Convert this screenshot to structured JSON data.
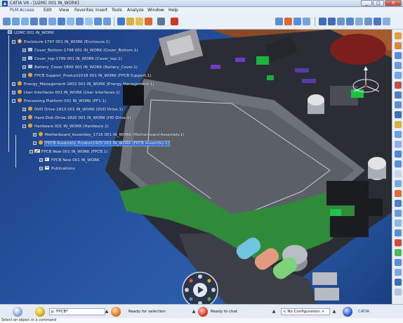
{
  "window": {
    "title": "CATIA V6 - [U2MC 001 IN_WORK]",
    "buttons": [
      "_",
      "□",
      "X"
    ]
  },
  "menu": [
    "PLM Access",
    "Edit",
    "View",
    "Favorites",
    "Insert",
    "Tools",
    "Analyze",
    "Window",
    "Help"
  ],
  "tree": {
    "root": "U2MC 001 IN_WORK",
    "nodes": [
      {
        "label": "Enclosure-1797 001 IN_WORK (Enclosure.1)"
      },
      {
        "label": "Cover_Bottom-1798 001 IN_WORK (Cover_Bottom.1)"
      },
      {
        "label": "Cover_top-1799 001 IN_WORK (Cover_top.1)"
      },
      {
        "label": "Battery_Cover-1800 001 IN_WORK (Battery_Cover.1)"
      },
      {
        "label": "FPCB Support_Product2018 001 IN_WORK (FPCB Support.1)"
      },
      {
        "label": "Energy_Management-1802 001 IN_WORK (Energy Management.1)"
      },
      {
        "label": "User Interfaces 001 IN_WORK (User Interfaces.1)"
      },
      {
        "label": "Processing Platform 001 IN_WORK (PF1.1)"
      },
      {
        "label": "DVD Drive-1813 001 IN_WORK (DVD Drive.1)"
      },
      {
        "label": "Hard-Disk-Drive-1820 001 IN_WORK (HD Drive.1)"
      },
      {
        "label": "Hardware 001 IN_WORK (Hardware.1)"
      },
      {
        "label": "Motherboard_Assembly_1716 001 IN_WORK (Motherboard Assembly.1)"
      },
      {
        "label": "FPCB Assembly_Product1925 001 IN_WORK (FPCB Assembly.1)"
      },
      {
        "label": "FPCB New 001 IN_WORK (FPCB.1)"
      },
      {
        "label": "FPCB New 001 IN_WORK"
      },
      {
        "label": "Publications"
      }
    ]
  },
  "status": {
    "search_value": "p: FPCB*",
    "ready_selection": "Ready for selection",
    "ready_chat": "Ready to chat",
    "configuration": "< No Configuration >",
    "brand": "CATIA",
    "command_prompt": "Select an object or a command"
  },
  "colors": {
    "viewport_bg": "#24509c",
    "selection": "#2f6fe3",
    "pcb_green": "#2f8a3a",
    "board_gray": "#6d7178"
  }
}
